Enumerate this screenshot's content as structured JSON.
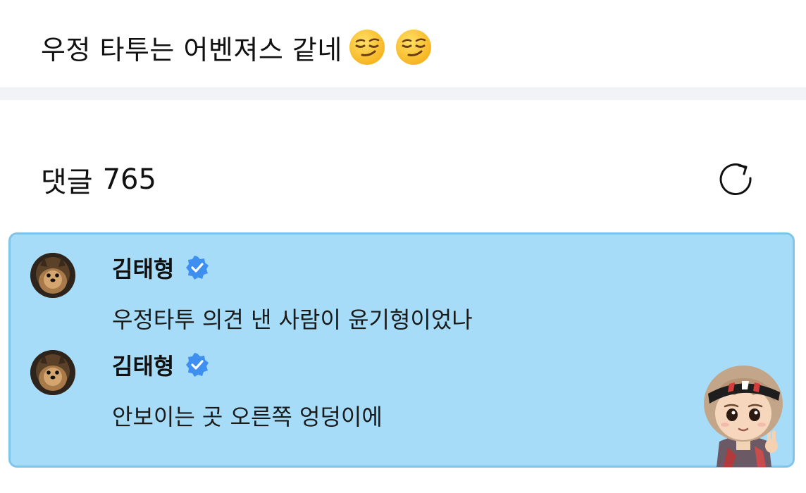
{
  "post": {
    "text": "우정 타투는 어벤져스 같네",
    "emojis": [
      "smirking-face",
      "smirking-face"
    ]
  },
  "comments_section": {
    "label": "댓글",
    "count": "765",
    "refresh_icon": "refresh-icon"
  },
  "highlight_color": "#a6dcf7",
  "verified_color": "#3d8ff0",
  "comments": [
    {
      "author": "김태형",
      "verified": true,
      "text": "우정타투 의견 낸 사람이 윤기형이었나"
    },
    {
      "author": "김태형",
      "verified": true,
      "text": "안보이는 곳 오른쪽 엉덩이에"
    }
  ]
}
